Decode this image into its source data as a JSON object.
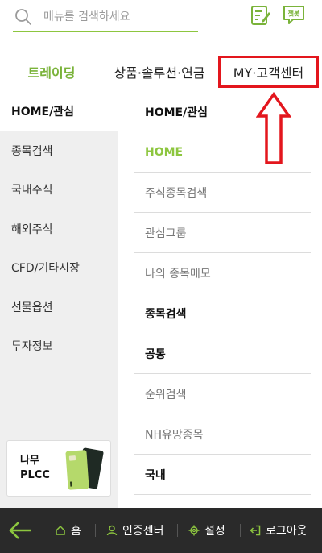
{
  "search": {
    "placeholder": "메뉴를 검색하세요",
    "chatbot_label": "챗봇"
  },
  "tabs": [
    {
      "label": "트레이딩"
    },
    {
      "label": "상품·솔루션·연금"
    },
    {
      "label": "MY·고객센터"
    }
  ],
  "left_menu": [
    {
      "label": "HOME/관심"
    },
    {
      "label": "종목검색"
    },
    {
      "label": "국내주식"
    },
    {
      "label": "해외주식"
    },
    {
      "label": "CFD/기타시장"
    },
    {
      "label": "선물옵션"
    },
    {
      "label": "투자정보"
    }
  ],
  "plcc": {
    "label_line1": "나무",
    "label_line2": "PLCC"
  },
  "right_menu": [
    {
      "label": "HOME/관심"
    },
    {
      "label": "HOME"
    },
    {
      "label": "주식종목검색"
    },
    {
      "label": "관심그룹"
    },
    {
      "label": "나의 종목메모"
    },
    {
      "label": "종목검색"
    },
    {
      "label": "공통"
    },
    {
      "label": "순위검색"
    },
    {
      "label": "NH유망종목"
    },
    {
      "label": "국내"
    }
  ],
  "bottom_bar": {
    "home": "홈",
    "auth": "인증센터",
    "settings": "설정",
    "logout": "로그아웃"
  },
  "colors": {
    "accent": "#8dc63f",
    "highlight": "#e3161d",
    "bottom_bar": "#2a2a2a"
  }
}
